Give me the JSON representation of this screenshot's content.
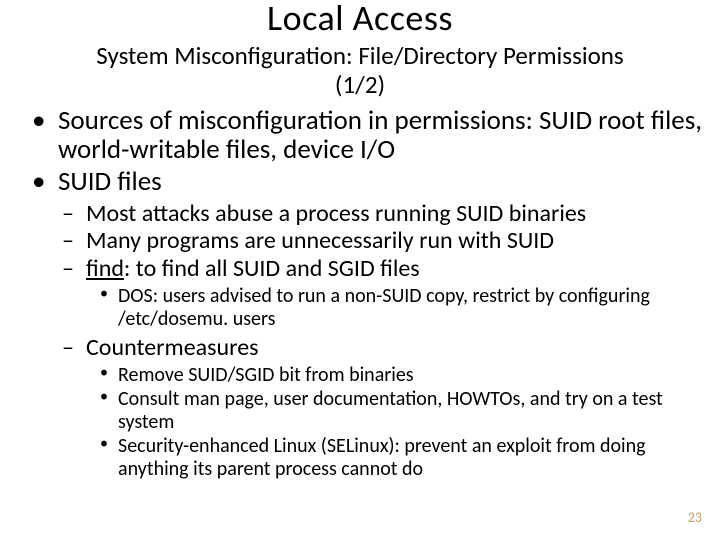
{
  "title": "Local Access",
  "subtitle_line1": "System Misconfiguration: File/Directory Permissions",
  "subtitle_line2": "(1/2)",
  "b1": "Sources of misconfiguration in permissions: SUID root files, world-writable files, device I/O",
  "b2": "SUID files",
  "s1": "Most attacks abuse a process running SUID binaries",
  "s2": "Many programs are unnecessarily run with SUID",
  "s3_pre": "find",
  "s3_post": ": to find all SUID and SGID files",
  "s3a": "DOS: users advised to run a non-SUID copy, restrict by configuring /etc/dosemu. users",
  "s4": "Countermeasures",
  "s4a": "Remove SUID/SGID bit from binaries",
  "s4b": "Consult man page, user documentation, HOWTOs, and try on a test system",
  "s4c": "Security-enhanced Linux (SELinux): prevent an exploit from doing anything its parent process cannot do",
  "page": "23"
}
